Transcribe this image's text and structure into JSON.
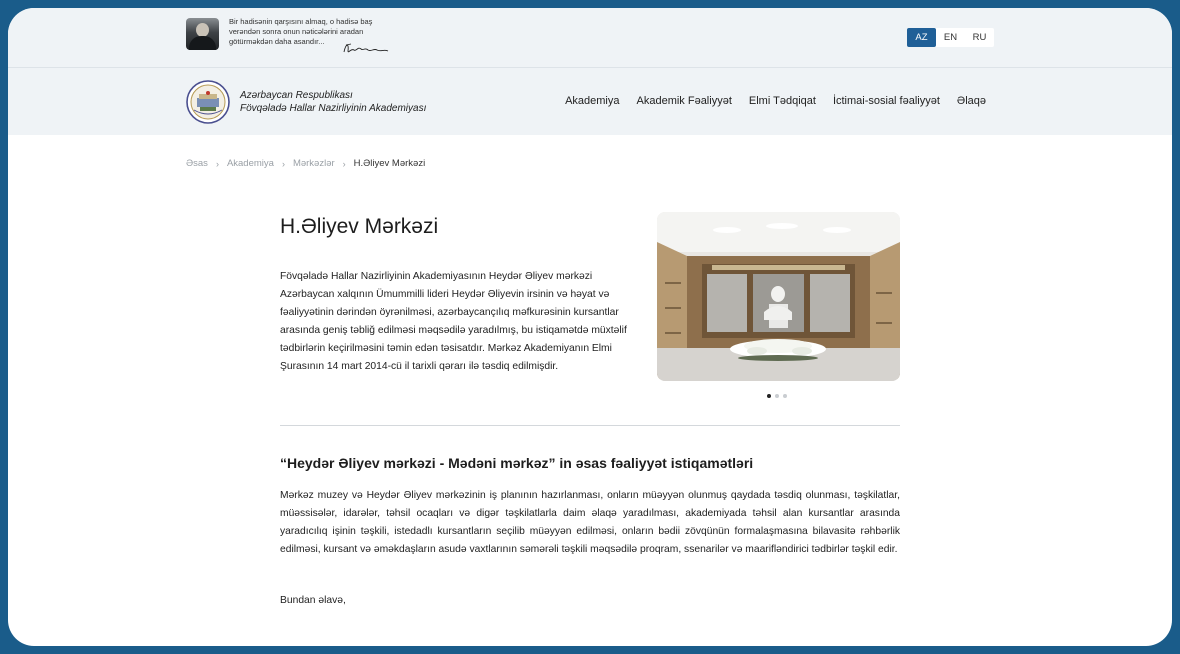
{
  "topbar": {
    "quote": "Bir hadisənin qarşısını almaq, o hadisə baş verəndən sonra onun nəticələrini aradan götürməkdən daha asandır...",
    "languages": [
      {
        "label": "AZ",
        "active": true
      },
      {
        "label": "EN",
        "active": false
      },
      {
        "label": "RU",
        "active": false
      }
    ]
  },
  "header": {
    "org_line1": "Azərbaycan Respublikası",
    "org_line2": "Fövqəladə Hallar Nazirliyinin Akademiyası",
    "nav": [
      "Akademiya",
      "Akademik Fəaliyyət",
      "Elmi Tədqiqat",
      "İctimai-sosial fəaliyyət",
      "Əlaqə"
    ]
  },
  "breadcrumb": {
    "items": [
      "Əsas",
      "Akademiya",
      "Mərkəzlər"
    ],
    "current": "H.Əliyev Mərkəzi"
  },
  "main": {
    "title": "H.Əliyev Mərkəzi",
    "intro": "Fövqəladə Hallar Nazirliyinin Akademiyasının Heydər Əliyev mərkəzi Azərbaycan xalqının Ümummilli lideri Heydər Əliyevin irsinin və həyat və fəaliyyətinin dərindən öyrənilməsi, azərbaycançılıq məfkurəsinin kursantlar arasında geniş təbliğ edilməsi məqsədilə yaradılmış, bu istiqamətdə müxtəlif tədbirlərin keçirilməsini təmin edən təsisatdır. Mərkəz Akademiyanın Elmi Şurasının 14 mart 2014-cü il tarixli qərarı ilə təsdiq edilmişdir.",
    "gallery": {
      "slides": 3,
      "active_slide": 1
    },
    "section_title": "“Heydər Əliyev mərkəzi - Mədəni mərkəz” in əsas fəaliyyət istiqamətləri",
    "section_body": "Mərkəz muzey və Heydər Əliyev mərkəzinin iş planının hazırlanması, onların müəyyən olunmuş qaydada təsdiq olunması, təşkilatlar, müəssisələr, idarələr, təhsil ocaqları və digər təşkilatlarla daim əlaqə yaradılması, akademiyada təhsil alan kursantlar arasında yaradıcılıq işinin təşkili, istedadlı kursantların seçilib müəyyən edilməsi, onların bədii zövqünün formalaşmasına bilavasitə rəhbərlik edilməsi, kursant və əməkdaşların asudə vaxtlarının səmərəli təşkili məqsədilə proqram, ssenarilər və maarifləndirici tədbirlər təşkil edir.",
    "closing": "Bundan əlavə,"
  },
  "colors": {
    "frame": "#1a5c8a",
    "accent": "#1f5f97",
    "header_bg": "#eff3f6"
  }
}
